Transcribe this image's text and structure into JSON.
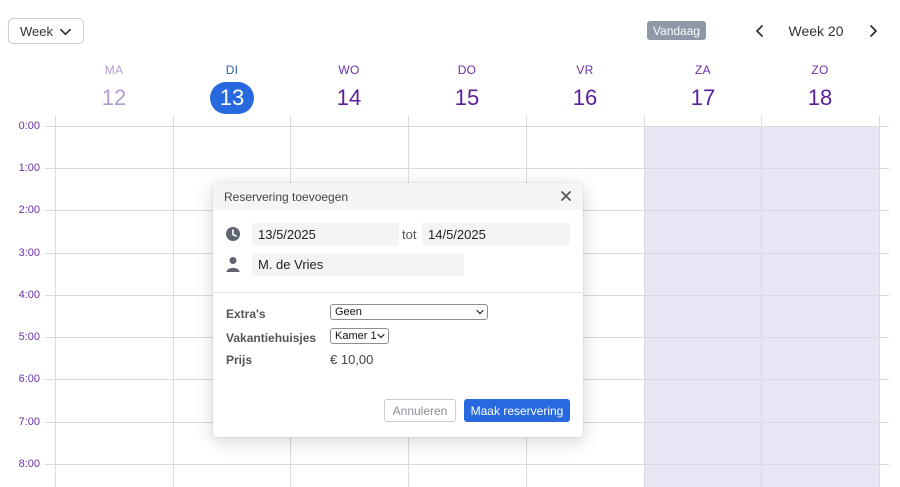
{
  "toolbar": {
    "view_select_value": "Week",
    "today_label": "Vandaag",
    "week_label": "Week 20"
  },
  "days": [
    {
      "name": "MA",
      "number": "12",
      "state": "past"
    },
    {
      "name": "DI",
      "number": "13",
      "state": "today"
    },
    {
      "name": "WO",
      "number": "14",
      "state": "future"
    },
    {
      "name": "DO",
      "number": "15",
      "state": "future"
    },
    {
      "name": "VR",
      "number": "16",
      "state": "future"
    },
    {
      "name": "ZA",
      "number": "17",
      "state": "weekend"
    },
    {
      "name": "ZO",
      "number": "18",
      "state": "weekend"
    }
  ],
  "hours": [
    "0:00",
    "1:00",
    "2:00",
    "3:00",
    "4:00",
    "5:00",
    "6:00",
    "7:00",
    "8:00"
  ],
  "dialog": {
    "title": "Reservering toevoegen",
    "start_date": "13/5/2025",
    "separator": "tot",
    "end_date": "14/5/2025",
    "guest_name": "M. de Vries",
    "extras_label": "Extra's",
    "extras_value": "Geen",
    "cabins_label": "Vakantiehuisjes",
    "cabins_value": "Kamer 1",
    "price_label": "Prijs",
    "price_value": "€ 10,00",
    "cancel_label": "Annuleren",
    "submit_label": "Maak reservering"
  },
  "colors": {
    "accent": "#2869e0",
    "day_text": "#5b1f9c",
    "weekend_bg": "#e8e6f5",
    "grid_line": "#d6dbe0"
  }
}
